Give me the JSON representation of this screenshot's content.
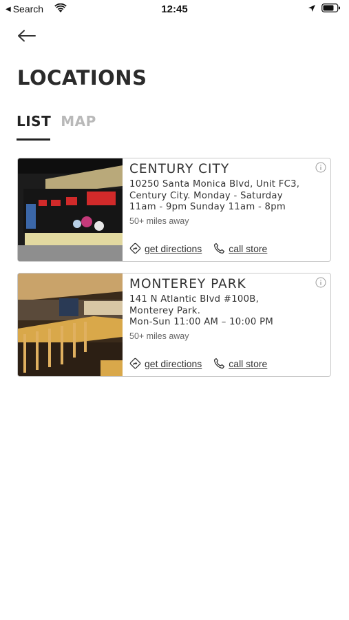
{
  "status_bar": {
    "back_app": "Search",
    "time": "12:45"
  },
  "header": {
    "back_icon": "arrow-left-icon",
    "title": "LOCATIONS"
  },
  "tabs": [
    {
      "label": "LIST",
      "active": true
    },
    {
      "label": "MAP",
      "active": false
    }
  ],
  "colors": {
    "text": "#2b2b2b",
    "inactive_tab": "#b9b9b9",
    "card_border": "#c9c9c9"
  },
  "locations": [
    {
      "name": "CENTURY CITY",
      "address_lines": [
        "10250 Santa Monica Blvd, Unit FC3,",
        "Century City. Monday - Saturday",
        "11am - 9pm Sunday 11am - 8pm"
      ],
      "distance": "50+ miles away",
      "directions_label": "get directions",
      "call_label": "call store"
    },
    {
      "name": "MONTEREY PARK",
      "address_lines": [
        "141 N Atlantic Blvd #100B,",
        "Monterey Park.",
        "Mon-Sun 11:00 AM – 10:00 PM"
      ],
      "distance": "50+ miles away",
      "directions_label": "get directions",
      "call_label": "call store"
    }
  ]
}
